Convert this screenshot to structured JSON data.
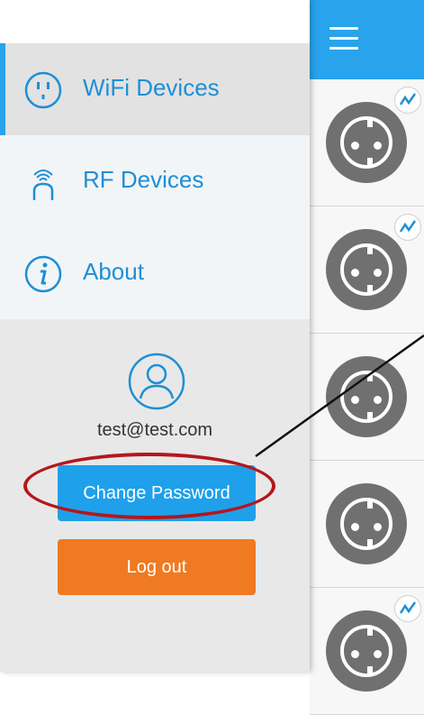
{
  "menu": {
    "items": [
      {
        "label": "WiFi Devices",
        "icon": "plug-outlet-icon",
        "active": true
      },
      {
        "label": "RF Devices",
        "icon": "rf-signal-icon",
        "active": false
      },
      {
        "label": "About",
        "icon": "info-icon",
        "active": false
      }
    ]
  },
  "user": {
    "email": "test@test.com",
    "change_password_label": "Change Password",
    "logout_label": "Log out"
  },
  "colors": {
    "accent": "#29a3ec",
    "logout": "#ef7a22",
    "annotation": "#b3171c"
  },
  "devices": [
    {
      "icon": "power-socket-icon",
      "badge": "chart-icon"
    },
    {
      "icon": "power-socket-icon",
      "badge": "chart-icon"
    },
    {
      "icon": "power-socket-icon",
      "badge": ""
    },
    {
      "icon": "power-socket-icon",
      "badge": ""
    },
    {
      "icon": "power-socket-icon",
      "badge": "chart-icon"
    }
  ]
}
